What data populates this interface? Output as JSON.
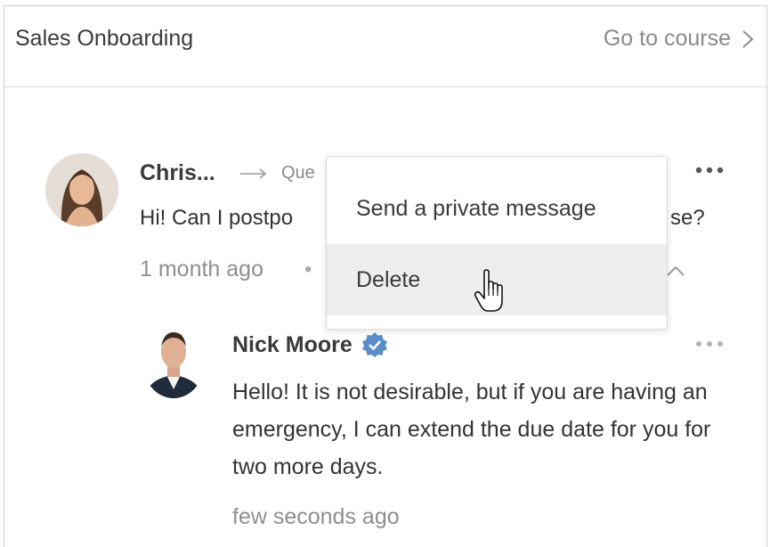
{
  "header": {
    "title": "Sales Onboarding",
    "go_to_course": "Go to course"
  },
  "comment": {
    "author": "Chris...",
    "target": "Que",
    "text_start": "Hi! Can I postpo",
    "text_end": "se?",
    "time": "1 month ago",
    "separator": "•"
  },
  "reply": {
    "author": "Nick Moore",
    "text": "Hello! It is not desirable, but if you are having an emergency,  I can extend the due date for you for two more days.",
    "time": "few seconds ago"
  },
  "context_menu": {
    "items": [
      "Send a private message",
      "Delete"
    ]
  },
  "icons": {
    "go": "chevron-right-icon",
    "arrow": "arrow-right-icon",
    "more": "more-horizontal-icon",
    "collapse": "chevron-up-icon",
    "verified": "verified-badge-icon",
    "cursor": "hand-pointer-cursor-icon"
  },
  "colors": {
    "verified_badge": "#5b8dc9",
    "menu_hover": "#eeeeee",
    "muted_text": "#8a8a8a"
  }
}
